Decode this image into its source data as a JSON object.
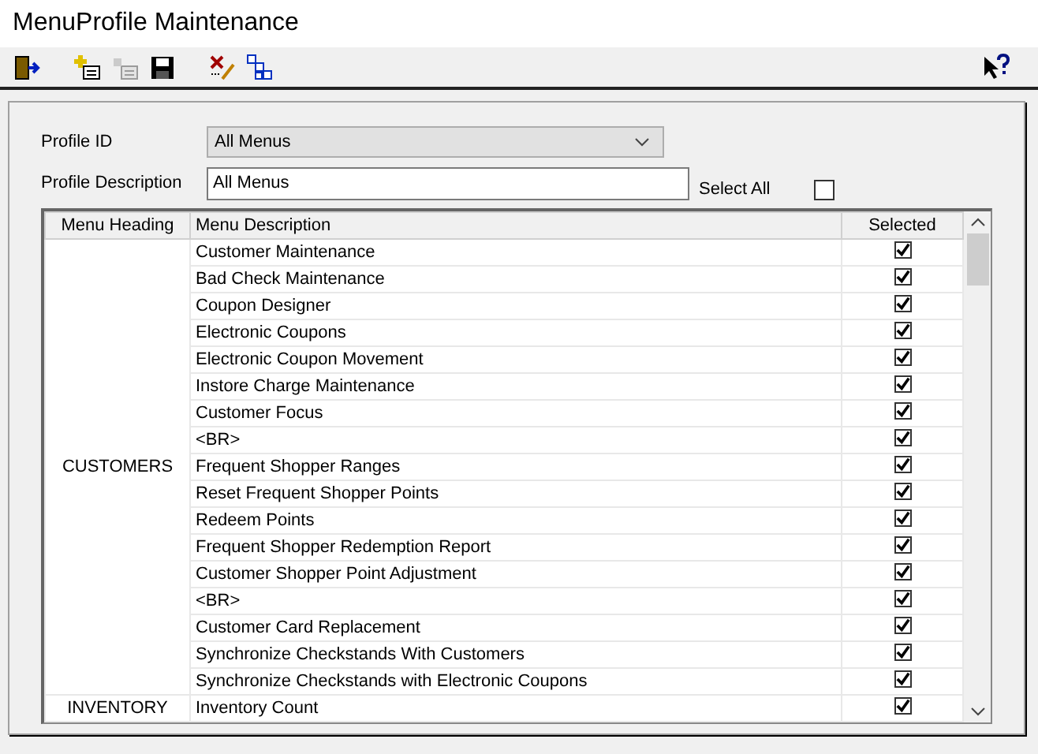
{
  "window": {
    "title": "MenuProfile Maintenance"
  },
  "toolbar": [
    {
      "kind": "exit",
      "disabled": false
    },
    {
      "kind": "new",
      "disabled": false
    },
    {
      "kind": "copy",
      "disabled": true
    },
    {
      "kind": "save",
      "disabled": false
    },
    {
      "kind": "delete",
      "disabled": false
    },
    {
      "kind": "tree",
      "disabled": false
    },
    {
      "kind": "help",
      "disabled": false
    }
  ],
  "profile_id": {
    "label": "Profile ID",
    "value": "All Menus"
  },
  "profile_description": {
    "label": "Profile Description",
    "value": "All Menus"
  },
  "select_all": {
    "label": "Select All",
    "checked": false
  },
  "table": {
    "columns": [
      "Menu Heading",
      "Menu Description",
      "Selected"
    ],
    "groups": [
      {
        "heading": "CUSTOMERS",
        "rows": [
          {
            "description": "Customer Maintenance",
            "selected": true
          },
          {
            "description": "Bad Check Maintenance",
            "selected": true
          },
          {
            "description": "Coupon Designer",
            "selected": true
          },
          {
            "description": "Electronic Coupons",
            "selected": true
          },
          {
            "description": "Electronic Coupon Movement",
            "selected": true
          },
          {
            "description": "Instore Charge Maintenance",
            "selected": true
          },
          {
            "description": "Customer Focus",
            "selected": true
          },
          {
            "description": "<BR>",
            "selected": true
          },
          {
            "description": "Frequent Shopper Ranges",
            "selected": true
          },
          {
            "description": "Reset Frequent Shopper Points",
            "selected": true
          },
          {
            "description": "Redeem Points",
            "selected": true
          },
          {
            "description": "Frequent Shopper Redemption Report",
            "selected": true
          },
          {
            "description": "Customer Shopper Point Adjustment",
            "selected": true
          },
          {
            "description": "<BR>",
            "selected": true
          },
          {
            "description": "Customer Card Replacement",
            "selected": true
          },
          {
            "description": "Synchronize Checkstands With Customers",
            "selected": true
          },
          {
            "description": "Synchronize Checkstands with Electronic Coupons",
            "selected": true
          }
        ]
      },
      {
        "heading": "INVENTORY",
        "rows": [
          {
            "description": "Inventory Count",
            "selected": true
          }
        ]
      }
    ]
  }
}
